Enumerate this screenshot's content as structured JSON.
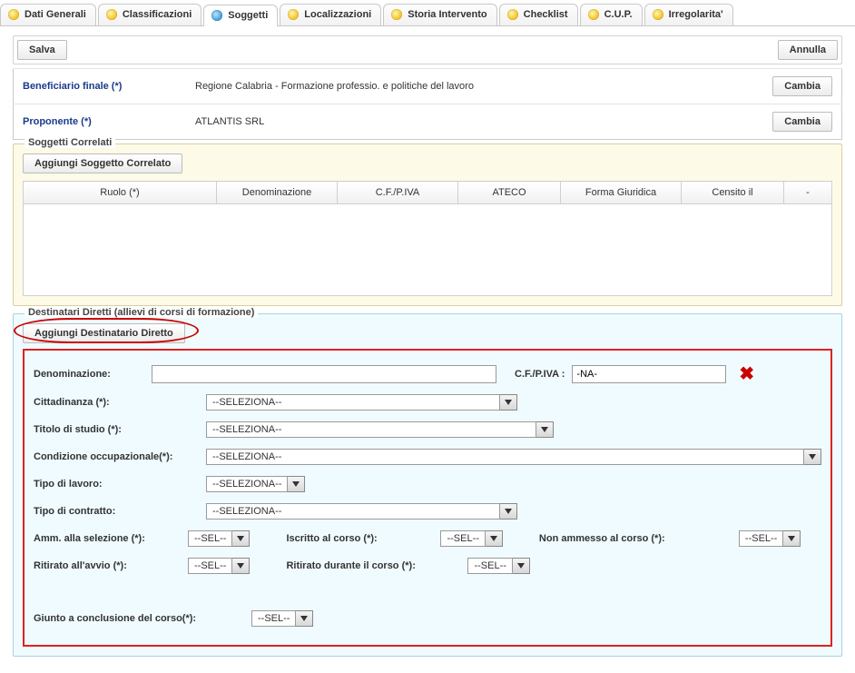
{
  "tabs": [
    {
      "label": "Dati Generali"
    },
    {
      "label": "Classificazioni"
    },
    {
      "label": "Soggetti"
    },
    {
      "label": "Localizzazioni"
    },
    {
      "label": "Storia Intervento"
    },
    {
      "label": "Checklist"
    },
    {
      "label": "C.U.P."
    },
    {
      "label": "Irregolarita'"
    }
  ],
  "actions": {
    "save": "Salva",
    "cancel": "Annulla",
    "change": "Cambia"
  },
  "beneficiario": {
    "label": "Beneficiario finale (*)",
    "value": "Regione Calabria - Formazione professio. e politiche del lavoro"
  },
  "proponente": {
    "label": "Proponente (*)",
    "value": "ATLANTIS SRL"
  },
  "soggettiCorrelati": {
    "legend": "Soggetti Correlati",
    "add": "Aggiungi Soggetto Correlato",
    "cols": [
      "Ruolo (*)",
      "Denominazione",
      "C.F./P.IVA",
      "ATECO",
      "Forma Giuridica",
      "Censito il",
      "-"
    ]
  },
  "destinatari": {
    "legend": "Destinatari Diretti (allievi di corsi di formazione)",
    "add": "Aggiungi Destinatario Diretto",
    "denominazione": {
      "label": "Denominazione:",
      "value": ""
    },
    "cfpiva": {
      "label": "C.F./P.IVA :",
      "value": "-NA-"
    },
    "cittadinanza": {
      "label": "Cittadinanza (*):",
      "value": "--SELEZIONA--"
    },
    "titolo": {
      "label": "Titolo di studio (*):",
      "value": "--SELEZIONA--"
    },
    "condizione": {
      "label": "Condizione occupazionale(*):",
      "value": "--SELEZIONA--"
    },
    "tipoLavoro": {
      "label": "Tipo di lavoro:",
      "value": "--SELEZIONA--"
    },
    "tipoContratto": {
      "label": "Tipo di contratto:",
      "value": "--SELEZIONA--"
    },
    "ammSelezione": {
      "label": "Amm. alla selezione (*):",
      "value": "--SEL--"
    },
    "iscritto": {
      "label": "Iscritto al corso (*):",
      "value": "--SEL--"
    },
    "nonAmmesso": {
      "label": "Non ammesso al corso (*):",
      "value": "--SEL--"
    },
    "ritiratoAvvio": {
      "label": "Ritirato all'avvio (*):",
      "value": "--SEL--"
    },
    "ritiratoDurante": {
      "label": "Ritirato durante il corso (*):",
      "value": "--SEL--"
    },
    "giunto": {
      "label": "Giunto a conclusione del corso(*):",
      "value": "--SEL--"
    }
  }
}
